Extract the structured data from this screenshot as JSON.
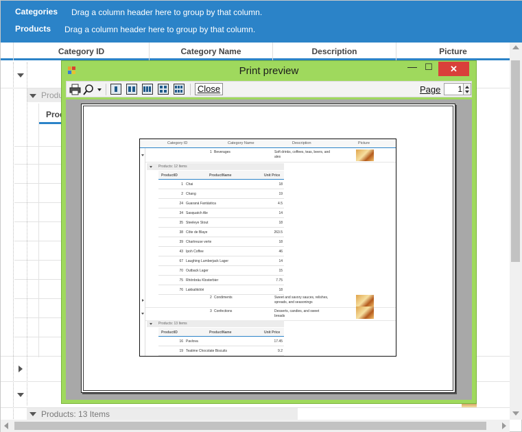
{
  "group_panels": [
    {
      "label": "Categories",
      "hint": "Drag a column header here to group by that column."
    },
    {
      "label": "Products",
      "hint": "Drag a column header here to group by that column."
    }
  ],
  "grid": {
    "columns": [
      "Category ID",
      "Category Name",
      "Description",
      "Picture"
    ],
    "sub_group_partial": "Produ",
    "sub_header_partial": "Prod",
    "bottom_group_label": "Products: 13 Items"
  },
  "print_preview": {
    "title": "Print preview",
    "minimize_glyph": "—",
    "maximize_glyph": "☐",
    "close_glyph": "✕",
    "toolbar": {
      "close_label": "Close",
      "page_label": "Page",
      "page_value": "1"
    },
    "page": {
      "columns": [
        "Category ID",
        "Category Name",
        "Description",
        "Picture"
      ],
      "categories": [
        {
          "id": "1",
          "name": "Beverages",
          "description": "Soft drinks, coffees, teas, beers, and ales"
        },
        {
          "id": "2",
          "name": "Condiments",
          "description": "Sweet and savory sauces, relishes, spreads, and seasonings"
        },
        {
          "id": "3",
          "name": "Confections",
          "description": "Desserts, candies, and sweet breads"
        }
      ],
      "group1_label": "Products: 12 Items",
      "group2_label": "Products: 13 Items",
      "product_columns": [
        "ProductID",
        "ProductName",
        "Unit Price"
      ],
      "products_group1": [
        {
          "id": "1",
          "name": "Chai",
          "price": "18"
        },
        {
          "id": "2",
          "name": "Chang",
          "price": "19"
        },
        {
          "id": "24",
          "name": "Guaraná Fantástica",
          "price": "4.5"
        },
        {
          "id": "34",
          "name": "Sasquatch Ale",
          "price": "14"
        },
        {
          "id": "35",
          "name": "Steeleye Stout",
          "price": "18"
        },
        {
          "id": "38",
          "name": "Côte de Blaye",
          "price": "263.5"
        },
        {
          "id": "39",
          "name": "Chartreuse verte",
          "price": "18"
        },
        {
          "id": "43",
          "name": "Ipoh Coffee",
          "price": "46"
        },
        {
          "id": "67",
          "name": "Laughing Lumberjack Lager",
          "price": "14"
        },
        {
          "id": "70",
          "name": "Outback Lager",
          "price": "15"
        },
        {
          "id": "75",
          "name": "Rhönbräu Klosterbier",
          "price": "7.75"
        },
        {
          "id": "76",
          "name": "Lakkalikööri",
          "price": "18"
        }
      ],
      "products_group2": [
        {
          "id": "16",
          "name": "Pavlova",
          "price": "17.45"
        },
        {
          "id": "19",
          "name": "Teatime Chocolate Biscuits",
          "price": "9.2"
        }
      ]
    }
  },
  "colors": {
    "accent": "#2b83c8",
    "window_frame": "#9fd95d",
    "close_red": "#d9403a"
  }
}
